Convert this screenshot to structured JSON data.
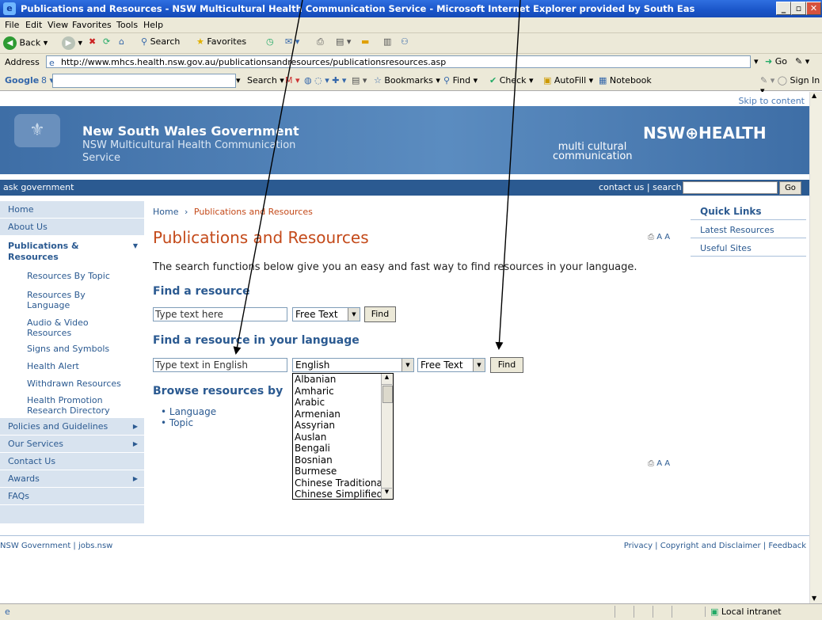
{
  "window": {
    "title": "Publications and Resources - NSW Multicultural Health Communication Service - Microsoft Internet Explorer provided by South Eas"
  },
  "menu": [
    "File",
    "Edit",
    "View",
    "Favorites",
    "Tools",
    "Help"
  ],
  "toolbar": {
    "back": "Back",
    "search": "Search",
    "favorites": "Favorites"
  },
  "address": {
    "label": "Address",
    "url": "http://www.mhcs.health.nsw.gov.au/publicationsandresources/publicationsresources.asp",
    "go": "Go"
  },
  "google_bar": {
    "label": "Google",
    "search": "Search",
    "bookmarks": "Bookmarks",
    "find": "Find",
    "check": "Check",
    "autofill": "AutoFill",
    "notebook": "Notebook",
    "signin": "Sign In"
  },
  "page": {
    "skip": "Skip to content",
    "gov_name": "New South Wales Government",
    "service": "NSW Multicultural Health Communication Service",
    "logo_mc": "multi cultural communication",
    "logo_nsw": "NSW⊕HEALTH",
    "ask": "ask government",
    "contact": "contact us | search",
    "go": "Go",
    "nav": {
      "home": "Home",
      "about": "About Us",
      "pubs": "Publications & Resources",
      "topic": "Resources By Topic",
      "lang": "Resources By Language",
      "av": "Audio & Video Resources",
      "signs": "Signs and Symbols",
      "alert": "Health Alert",
      "withdrawn": "Withdrawn Resources",
      "hprd": "Health Promotion Research Directory",
      "policies": "Policies and Guidelines",
      "services": "Our Services",
      "contact": "Contact Us",
      "awards": "Awards",
      "faqs": "FAQs"
    },
    "breadcrumb_home": "Home",
    "breadcrumb_sep": "›",
    "breadcrumb_current": "Publications and Resources",
    "heading": "Publications and Resources",
    "font_controls": "A A",
    "intro": "The search functions below give you an easy and fast way to find resources in your language.",
    "find_heading": "Find a resource",
    "find_placeholder": "Type text here",
    "find_type": "Free Text",
    "find_btn": "Find",
    "lang_heading": "Find a resource in your language",
    "lang_placeholder": "Type text in English",
    "lang_selected": "English",
    "lang_type": "Free Text",
    "lang_btn": "Find",
    "languages": [
      "Albanian",
      "Amharic",
      "Arabic",
      "Armenian",
      "Assyrian",
      "Auslan",
      "Bengali",
      "Bosnian",
      "Burmese",
      "Chinese Traditional",
      "Chinese Simplified"
    ],
    "browse_heading": "Browse resources by",
    "browse": [
      "Language",
      "Topic"
    ],
    "quick_links": {
      "title": "Quick Links",
      "latest": "Latest Resources",
      "useful": "Useful Sites"
    },
    "footer_left": "NSW Government | jobs.nsw",
    "footer_right": "Privacy | Copyright and Disclaimer | Feedback"
  },
  "status": {
    "zone": "Local intranet"
  }
}
